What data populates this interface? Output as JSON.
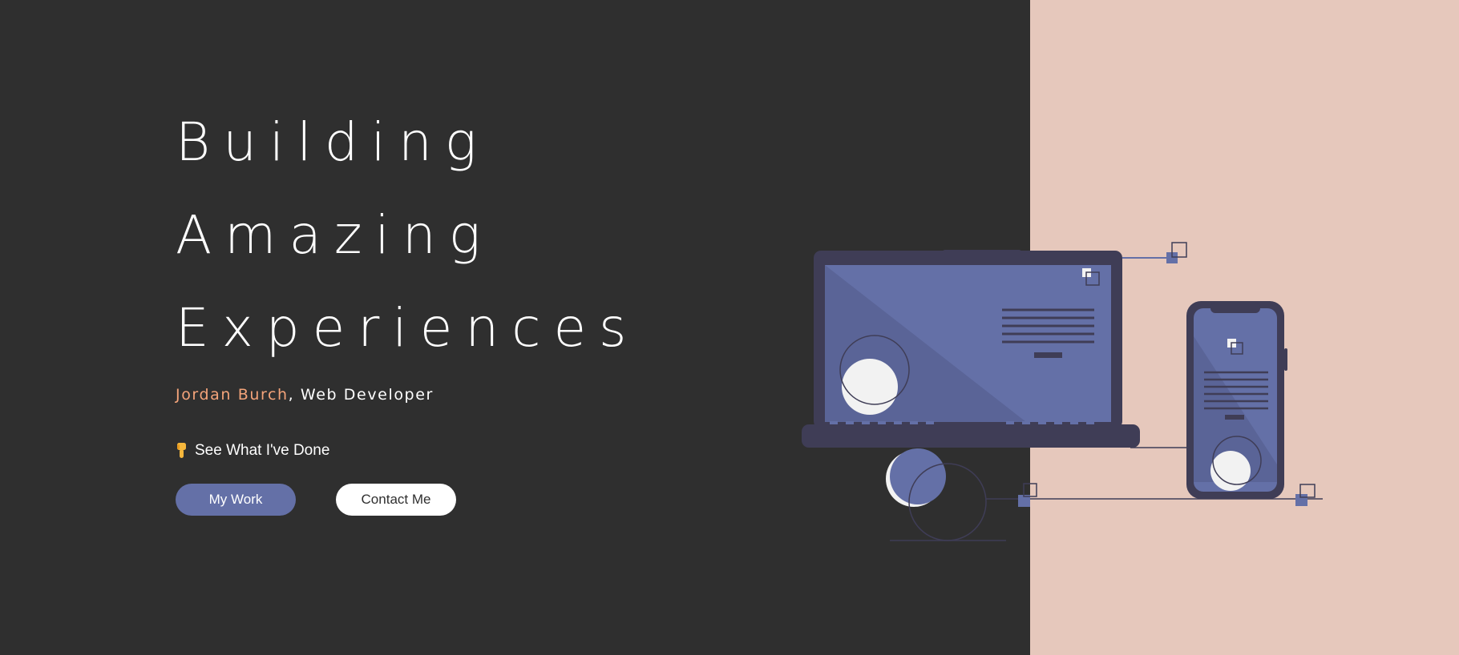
{
  "hero": {
    "headline": [
      "Building",
      "Amazing",
      "Experiences"
    ],
    "name": "Jordan Burch",
    "role_suffix": ", Web Developer",
    "see_work_label": "See What I've Done",
    "see_work_icon": "pointing-down-hand-icon"
  },
  "buttons": {
    "my_work": "My Work",
    "contact_me": "Contact Me"
  },
  "illustration": {
    "name": "devices-illustration",
    "icons": [
      "laptop-icon",
      "smartphone-icon"
    ]
  },
  "colors": {
    "background": "#2f2f2f",
    "panel": "#e6c8bc",
    "accent_name": "#f4a47a",
    "primary_button": "#6470a7",
    "device_dark": "#3f3d56",
    "device_screen": "#6470a7",
    "circle_light": "#f2f2f2"
  }
}
